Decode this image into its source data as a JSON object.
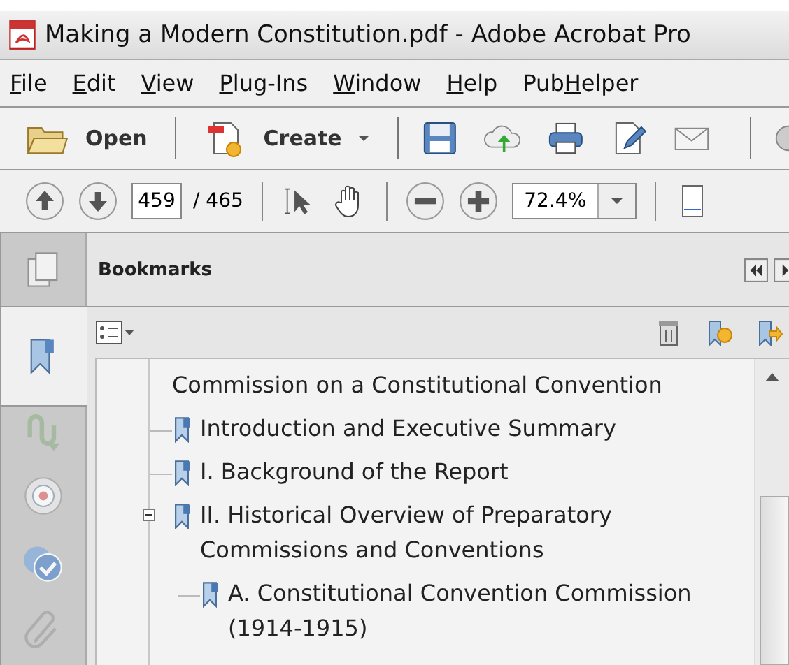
{
  "window": {
    "title": "Making a Modern Constitution.pdf - Adobe Acrobat Pro"
  },
  "menu": [
    {
      "key": "F",
      "after": "ile"
    },
    {
      "key": "E",
      "after": "dit"
    },
    {
      "key": "V",
      "after": "iew"
    },
    {
      "key": "P",
      "after": "lug-Ins"
    },
    {
      "key": "W",
      "after": "indow"
    },
    {
      "key": "H",
      "after": "elp"
    },
    {
      "before": "Pub",
      "key": "H",
      "after": "elper"
    }
  ],
  "toolbar": {
    "open": "Open",
    "create": "Create"
  },
  "navigation": {
    "page": "459",
    "total": "/ 465",
    "zoom": "72.4%"
  },
  "sidebar": {
    "tabs": [
      {
        "selected": false
      },
      {
        "selected": true
      },
      {
        "selected": false
      },
      {
        "selected": false
      },
      {
        "selected": false
      },
      {
        "selected": false
      }
    ]
  },
  "panel": {
    "title": "Bookmarks"
  },
  "bookmarks": [
    {
      "text": "Commission on a Constitutional Convention",
      "kind": "continued"
    },
    {
      "text": "Introduction and Executive Summary",
      "kind": "bookmark"
    },
    {
      "text": "I. Background of the Report",
      "kind": "bookmark"
    },
    {
      "text": "II. Historical Overview of Preparatory Commissions and Conventions",
      "kind": "bookmark",
      "expanded": true,
      "children": [
        {
          "text": "A. Constitutional Convention Commission (1914-1915)",
          "kind": "bookmark"
        }
      ]
    }
  ]
}
